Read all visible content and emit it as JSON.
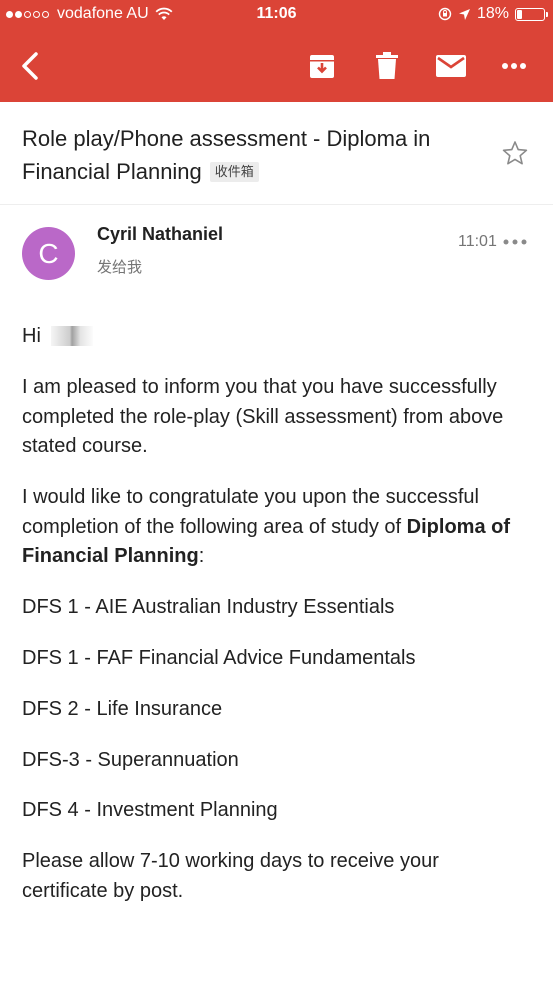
{
  "status_bar": {
    "carrier": "vodafone AU",
    "time": "11:06",
    "battery_percent": "18%",
    "battery_level": 0.18
  },
  "toolbar": {
    "back_icon": "back-arrow-icon",
    "archive_icon": "archive-icon",
    "delete_icon": "trash-icon",
    "mark_unread_icon": "envelope-icon",
    "more_icon": "more-horizontal-icon"
  },
  "email": {
    "subject": "Role play/Phone assessment - Diploma in Financial Planning",
    "label": "收件箱",
    "sender_initial": "C",
    "sender_name": "Cyril Nathaniel",
    "recipient": "发给我",
    "time": "11:01",
    "avatar_color": "#ba68c8",
    "body": {
      "greeting": "Hi",
      "para1": "I am pleased to inform you that you have successfully completed the role-play (Skill assessment) from above stated course.",
      "para2_prefix": "I would like to congratulate you upon the successful completion of the following area of study of ",
      "para2_bold": "Diploma of Financial Planning",
      "para2_suffix": ":",
      "units": [
        "DFS 1 - AIE Australian Industry Essentials",
        "DFS 1 - FAF Financial Advice Fundamentals",
        "DFS 2 - Life Insurance",
        "DFS-3 - Superannuation",
        "DFS 4 - Investment Planning"
      ],
      "closing": "Please allow 7-10 working days to receive your certificate by post."
    }
  },
  "colors": {
    "header_red": "#db4437",
    "text_dark": "#212121",
    "text_grey": "#757575"
  }
}
